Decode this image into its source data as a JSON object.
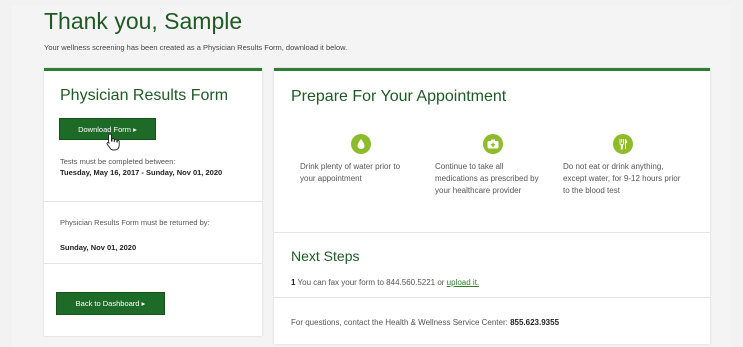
{
  "header": {
    "title": "Thank you, Sample",
    "subtitle": "Your wellness screening has been created as a Physician Results Form, download it below."
  },
  "left_card": {
    "title": "Physician Results Form",
    "download_label": "Download Form ▸",
    "tests_label": "Tests must be completed between:",
    "tests_dates": "Tuesday, May 16, 2017 - Sunday, Nov 01, 2020",
    "return_label": "Physician Results Form must be returned by:",
    "return_date": "Sunday, Nov 01, 2020",
    "back_label": "Back to Dashboard ▸"
  },
  "right_card": {
    "title": "Prepare For Your Appointment",
    "tips": [
      {
        "icon": "water-drop-icon",
        "text": "Drink plenty of water prior to your appointment"
      },
      {
        "icon": "medication-icon",
        "text": "Continue to take all medications as prescribed by your healthcare provider"
      },
      {
        "icon": "no-food-icon",
        "text": "Do not eat or drink anything, except water, for 9-12 hours prior to the blood test"
      }
    ],
    "next_steps_title": "Next Steps",
    "step_number": "1",
    "step_text": "You can fax your form to 844.560.5221 or ",
    "step_link": "upload it.",
    "contact_text": "For questions, contact the Health & Wellness Service Center: ",
    "contact_phone": "855.623.9355"
  },
  "colors": {
    "brand_green": "#1f5a26",
    "button_green": "#1e6b27",
    "icon_green": "#8dbb2a"
  }
}
